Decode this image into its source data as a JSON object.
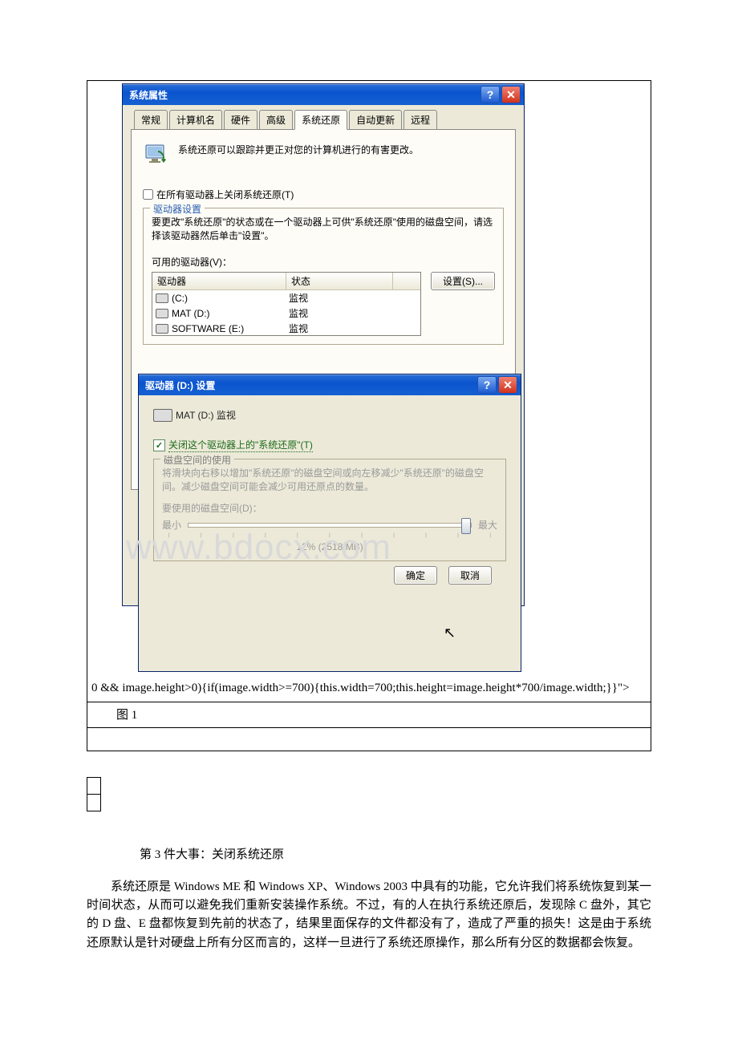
{
  "screenshot": {
    "main_dialog": {
      "title": "系统属性",
      "tabs": [
        "常规",
        "计算机名",
        "硬件",
        "高级",
        "系统还原",
        "自动更新",
        "远程"
      ],
      "active_tab_index": 4,
      "intro": "系统还原可以跟踪并更正对您的计算机进行的有害更改。",
      "disable_all": {
        "label": "在所有驱动器上关闭系统还原(T)",
        "checked": false
      },
      "group_legend": "驱动器设置",
      "group_text": "要更改\"系统还原\"的状态或在一个驱动器上可供\"系统还原\"使用的磁盘空间，请选择该驱动器然后单击\"设置\"。",
      "avail_label": "可用的驱动器(V)：",
      "header_drive": "驱动器",
      "header_status": "状态",
      "settings_btn": "设置(S)...",
      "drives": [
        {
          "name": "(C:)",
          "status": "监视"
        },
        {
          "name": "MAT (D:)",
          "status": "监视"
        },
        {
          "name": "SOFTWARE (E:)",
          "status": "监视"
        }
      ]
    },
    "sub_dialog": {
      "title": "驱动器 (D:) 设置",
      "drive_line": "MAT (D:) 监视",
      "disable_label": "关闭这个驱动器上的\"系统还原\"(T)",
      "du_legend": "磁盘空间的使用",
      "du_text": "将滑块向右移以增加\"系统还原\"的磁盘空间或向左移减少\"系统还原\"的磁盘空间。减少磁盘空间可能会减少可用还原点的数量。",
      "du_use_label": "要使用的磁盘空间(D)：",
      "min": "最小",
      "max": "最大",
      "pct": "12% (2518 MB)",
      "ok": "确定",
      "cancel": "取消"
    },
    "watermark": "www.bdocx.com"
  },
  "code_fragment": "0 && image.height>0){if(image.width>=700){this.width=700;this.height=image.height*700/image.width;}}\">",
  "caption": "图 1",
  "heading": "第 3 件大事：关闭系统还原",
  "paragraph_parts": [
    "系统还原是 ",
    "Windows ME",
    " 和 ",
    "Windows XP",
    "、",
    "Windows 2003",
    " 中具有的功能，它允许我们将系统恢复到某一时间状态，从而可以避免我们重新安装操作系统。不过，有的人在执行系统还原后，发现除 ",
    "C",
    " 盘外，其它的 ",
    "D",
    " 盘、",
    "E",
    " 盘都恢复到先前的状态了，结果里面保存的文件都没有了，造成了严重的损失！这是由于系统还原默认是针对硬盘上所有分区而言的，这样一旦进行了系统还原操作，那么所有分区的数据都会恢复。"
  ]
}
